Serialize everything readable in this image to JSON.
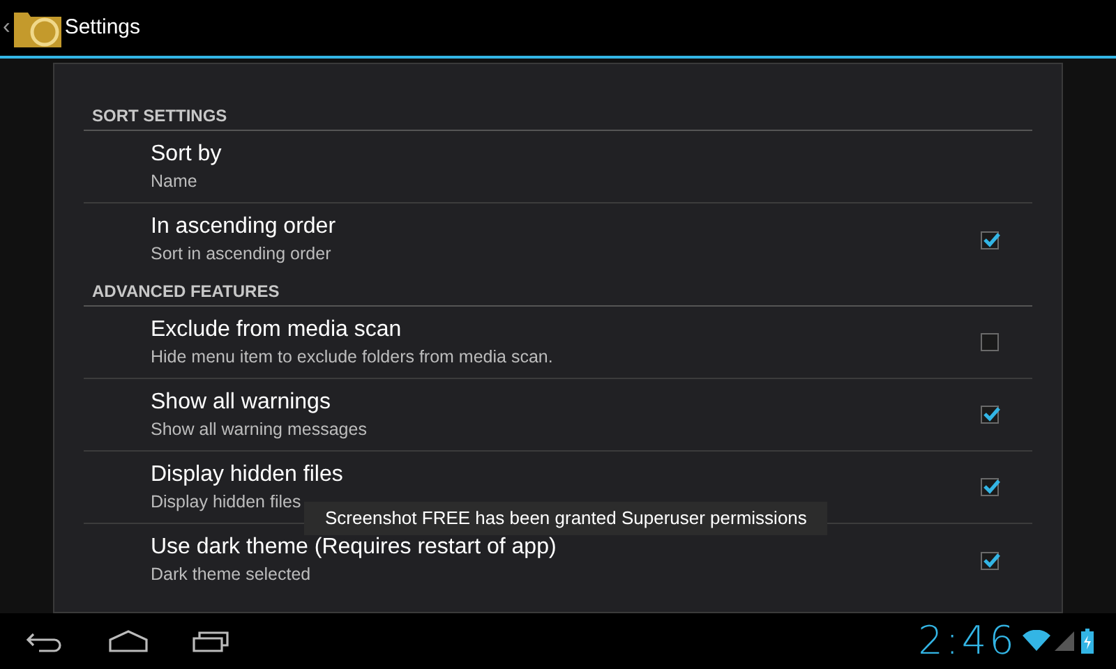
{
  "action_bar": {
    "back": "‹",
    "title": "Settings"
  },
  "sections": [
    {
      "header": "SORT SETTINGS",
      "items": [
        {
          "kind": "list",
          "title": "Sort by",
          "summary": "Name"
        },
        {
          "kind": "checkbox",
          "title": "In ascending order",
          "summary": "Sort in ascending order",
          "checked": true
        }
      ]
    },
    {
      "header": "ADVANCED FEATURES",
      "items": [
        {
          "kind": "checkbox",
          "title": "Exclude from media scan",
          "summary": "Hide menu item to exclude folders from media scan.",
          "checked": false
        },
        {
          "kind": "checkbox",
          "title": "Show all warnings",
          "summary": "Show all warning messages",
          "checked": true
        },
        {
          "kind": "checkbox",
          "title": "Display hidden files",
          "summary": "Display hidden files",
          "checked": true
        },
        {
          "kind": "checkbox",
          "title": "Use dark theme (Requires restart of app)",
          "summary": "Dark theme selected",
          "checked": true
        }
      ]
    }
  ],
  "toast": "Screenshot FREE has been granted Superuser permissions",
  "status": {
    "time": "2:46"
  }
}
